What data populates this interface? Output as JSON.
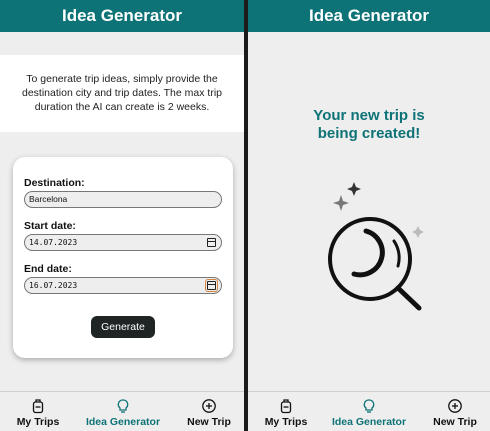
{
  "left": {
    "header_title": "Idea Generator",
    "intro_text": "To generate trip ideas, simply provide the destination city and trip dates. The max trip duration the AI can create is 2 weeks.",
    "form": {
      "destination_label": "Destination:",
      "destination_value": "Barcelona",
      "start_label": "Start date:",
      "start_value": "14.07.2023",
      "end_label": "End date:",
      "end_value": "16.07.2023",
      "generate_label": "Generate"
    },
    "tabs": [
      {
        "label": "My Trips",
        "icon": "luggage-icon",
        "active": false
      },
      {
        "label": "Idea Generator",
        "icon": "lightbulb-icon",
        "active": true
      },
      {
        "label": "New Trip",
        "icon": "plus-circle-icon",
        "active": false
      }
    ]
  },
  "right": {
    "header_title": "Idea Generator",
    "status_line1": "Your new trip is",
    "status_line2": "being created!",
    "animation_icon": "magnifier-sparkle-icon",
    "tabs": [
      {
        "label": "My Trips",
        "icon": "luggage-icon",
        "active": false
      },
      {
        "label": "Idea Generator",
        "icon": "lightbulb-icon",
        "active": true
      },
      {
        "label": "New Trip",
        "icon": "plus-circle-icon",
        "active": false
      }
    ]
  },
  "colors": {
    "primary": "#0e7377",
    "background": "#eeeeee",
    "button": "#1f2524",
    "divider": "#1b1b1b"
  }
}
